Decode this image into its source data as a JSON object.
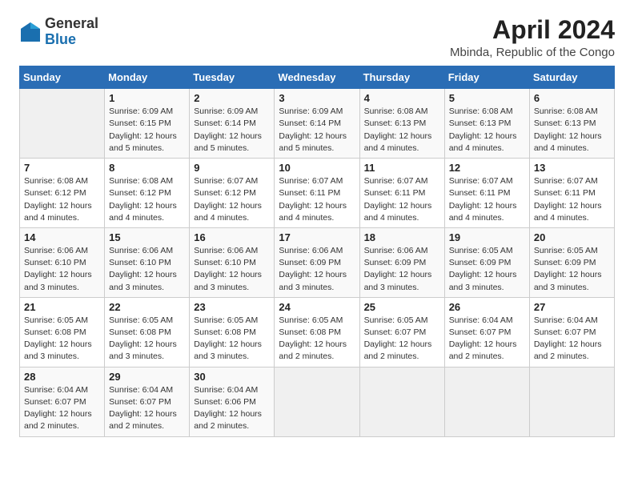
{
  "logo": {
    "general": "General",
    "blue": "Blue"
  },
  "title": "April 2024",
  "location": "Mbinda, Republic of the Congo",
  "days_header": [
    "Sunday",
    "Monday",
    "Tuesday",
    "Wednesday",
    "Thursday",
    "Friday",
    "Saturday"
  ],
  "weeks": [
    [
      {
        "day": null
      },
      {
        "day": "1",
        "sunrise": "Sunrise: 6:09 AM",
        "sunset": "Sunset: 6:15 PM",
        "daylight": "Daylight: 12 hours and 5 minutes."
      },
      {
        "day": "2",
        "sunrise": "Sunrise: 6:09 AM",
        "sunset": "Sunset: 6:14 PM",
        "daylight": "Daylight: 12 hours and 5 minutes."
      },
      {
        "day": "3",
        "sunrise": "Sunrise: 6:09 AM",
        "sunset": "Sunset: 6:14 PM",
        "daylight": "Daylight: 12 hours and 5 minutes."
      },
      {
        "day": "4",
        "sunrise": "Sunrise: 6:08 AM",
        "sunset": "Sunset: 6:13 PM",
        "daylight": "Daylight: 12 hours and 4 minutes."
      },
      {
        "day": "5",
        "sunrise": "Sunrise: 6:08 AM",
        "sunset": "Sunset: 6:13 PM",
        "daylight": "Daylight: 12 hours and 4 minutes."
      },
      {
        "day": "6",
        "sunrise": "Sunrise: 6:08 AM",
        "sunset": "Sunset: 6:13 PM",
        "daylight": "Daylight: 12 hours and 4 minutes."
      }
    ],
    [
      {
        "day": "7",
        "sunrise": "Sunrise: 6:08 AM",
        "sunset": "Sunset: 6:12 PM",
        "daylight": "Daylight: 12 hours and 4 minutes."
      },
      {
        "day": "8",
        "sunrise": "Sunrise: 6:08 AM",
        "sunset": "Sunset: 6:12 PM",
        "daylight": "Daylight: 12 hours and 4 minutes."
      },
      {
        "day": "9",
        "sunrise": "Sunrise: 6:07 AM",
        "sunset": "Sunset: 6:12 PM",
        "daylight": "Daylight: 12 hours and 4 minutes."
      },
      {
        "day": "10",
        "sunrise": "Sunrise: 6:07 AM",
        "sunset": "Sunset: 6:11 PM",
        "daylight": "Daylight: 12 hours and 4 minutes."
      },
      {
        "day": "11",
        "sunrise": "Sunrise: 6:07 AM",
        "sunset": "Sunset: 6:11 PM",
        "daylight": "Daylight: 12 hours and 4 minutes."
      },
      {
        "day": "12",
        "sunrise": "Sunrise: 6:07 AM",
        "sunset": "Sunset: 6:11 PM",
        "daylight": "Daylight: 12 hours and 4 minutes."
      },
      {
        "day": "13",
        "sunrise": "Sunrise: 6:07 AM",
        "sunset": "Sunset: 6:11 PM",
        "daylight": "Daylight: 12 hours and 4 minutes."
      }
    ],
    [
      {
        "day": "14",
        "sunrise": "Sunrise: 6:06 AM",
        "sunset": "Sunset: 6:10 PM",
        "daylight": "Daylight: 12 hours and 3 minutes."
      },
      {
        "day": "15",
        "sunrise": "Sunrise: 6:06 AM",
        "sunset": "Sunset: 6:10 PM",
        "daylight": "Daylight: 12 hours and 3 minutes."
      },
      {
        "day": "16",
        "sunrise": "Sunrise: 6:06 AM",
        "sunset": "Sunset: 6:10 PM",
        "daylight": "Daylight: 12 hours and 3 minutes."
      },
      {
        "day": "17",
        "sunrise": "Sunrise: 6:06 AM",
        "sunset": "Sunset: 6:09 PM",
        "daylight": "Daylight: 12 hours and 3 minutes."
      },
      {
        "day": "18",
        "sunrise": "Sunrise: 6:06 AM",
        "sunset": "Sunset: 6:09 PM",
        "daylight": "Daylight: 12 hours and 3 minutes."
      },
      {
        "day": "19",
        "sunrise": "Sunrise: 6:05 AM",
        "sunset": "Sunset: 6:09 PM",
        "daylight": "Daylight: 12 hours and 3 minutes."
      },
      {
        "day": "20",
        "sunrise": "Sunrise: 6:05 AM",
        "sunset": "Sunset: 6:09 PM",
        "daylight": "Daylight: 12 hours and 3 minutes."
      }
    ],
    [
      {
        "day": "21",
        "sunrise": "Sunrise: 6:05 AM",
        "sunset": "Sunset: 6:08 PM",
        "daylight": "Daylight: 12 hours and 3 minutes."
      },
      {
        "day": "22",
        "sunrise": "Sunrise: 6:05 AM",
        "sunset": "Sunset: 6:08 PM",
        "daylight": "Daylight: 12 hours and 3 minutes."
      },
      {
        "day": "23",
        "sunrise": "Sunrise: 6:05 AM",
        "sunset": "Sunset: 6:08 PM",
        "daylight": "Daylight: 12 hours and 3 minutes."
      },
      {
        "day": "24",
        "sunrise": "Sunrise: 6:05 AM",
        "sunset": "Sunset: 6:08 PM",
        "daylight": "Daylight: 12 hours and 2 minutes."
      },
      {
        "day": "25",
        "sunrise": "Sunrise: 6:05 AM",
        "sunset": "Sunset: 6:07 PM",
        "daylight": "Daylight: 12 hours and 2 minutes."
      },
      {
        "day": "26",
        "sunrise": "Sunrise: 6:04 AM",
        "sunset": "Sunset: 6:07 PM",
        "daylight": "Daylight: 12 hours and 2 minutes."
      },
      {
        "day": "27",
        "sunrise": "Sunrise: 6:04 AM",
        "sunset": "Sunset: 6:07 PM",
        "daylight": "Daylight: 12 hours and 2 minutes."
      }
    ],
    [
      {
        "day": "28",
        "sunrise": "Sunrise: 6:04 AM",
        "sunset": "Sunset: 6:07 PM",
        "daylight": "Daylight: 12 hours and 2 minutes."
      },
      {
        "day": "29",
        "sunrise": "Sunrise: 6:04 AM",
        "sunset": "Sunset: 6:07 PM",
        "daylight": "Daylight: 12 hours and 2 minutes."
      },
      {
        "day": "30",
        "sunrise": "Sunrise: 6:04 AM",
        "sunset": "Sunset: 6:06 PM",
        "daylight": "Daylight: 12 hours and 2 minutes."
      },
      {
        "day": null
      },
      {
        "day": null
      },
      {
        "day": null
      },
      {
        "day": null
      }
    ]
  ]
}
